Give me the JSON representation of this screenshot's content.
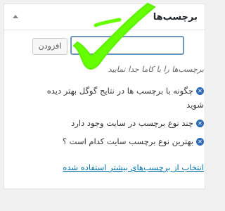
{
  "panel": {
    "title": "برچسب‌ها",
    "add_button_label": "افزودن",
    "input_value": "",
    "hint": "برچسب‌ها را با کاما جدا نمایید",
    "tags": [
      "چگونه با برچسب ها در نتایج گوگل بهتر دیده شوید",
      "چند نوع برچسب در سایت وجود دارد",
      "بهترین نوع برچسب سایت کدام است ؟"
    ],
    "popular_link": "انتخاب از برچسب‌های بیشتر استفاده شده",
    "remove_symbol": "✕"
  },
  "colors": {
    "accent": "#0073aa",
    "remove_icon": "#2e6ab3",
    "annotation_check": "#66ff00"
  },
  "icons": {
    "collapse": "triangle-up-icon",
    "remove": "remove-circle-icon",
    "annotation": "checkmark-icon"
  }
}
